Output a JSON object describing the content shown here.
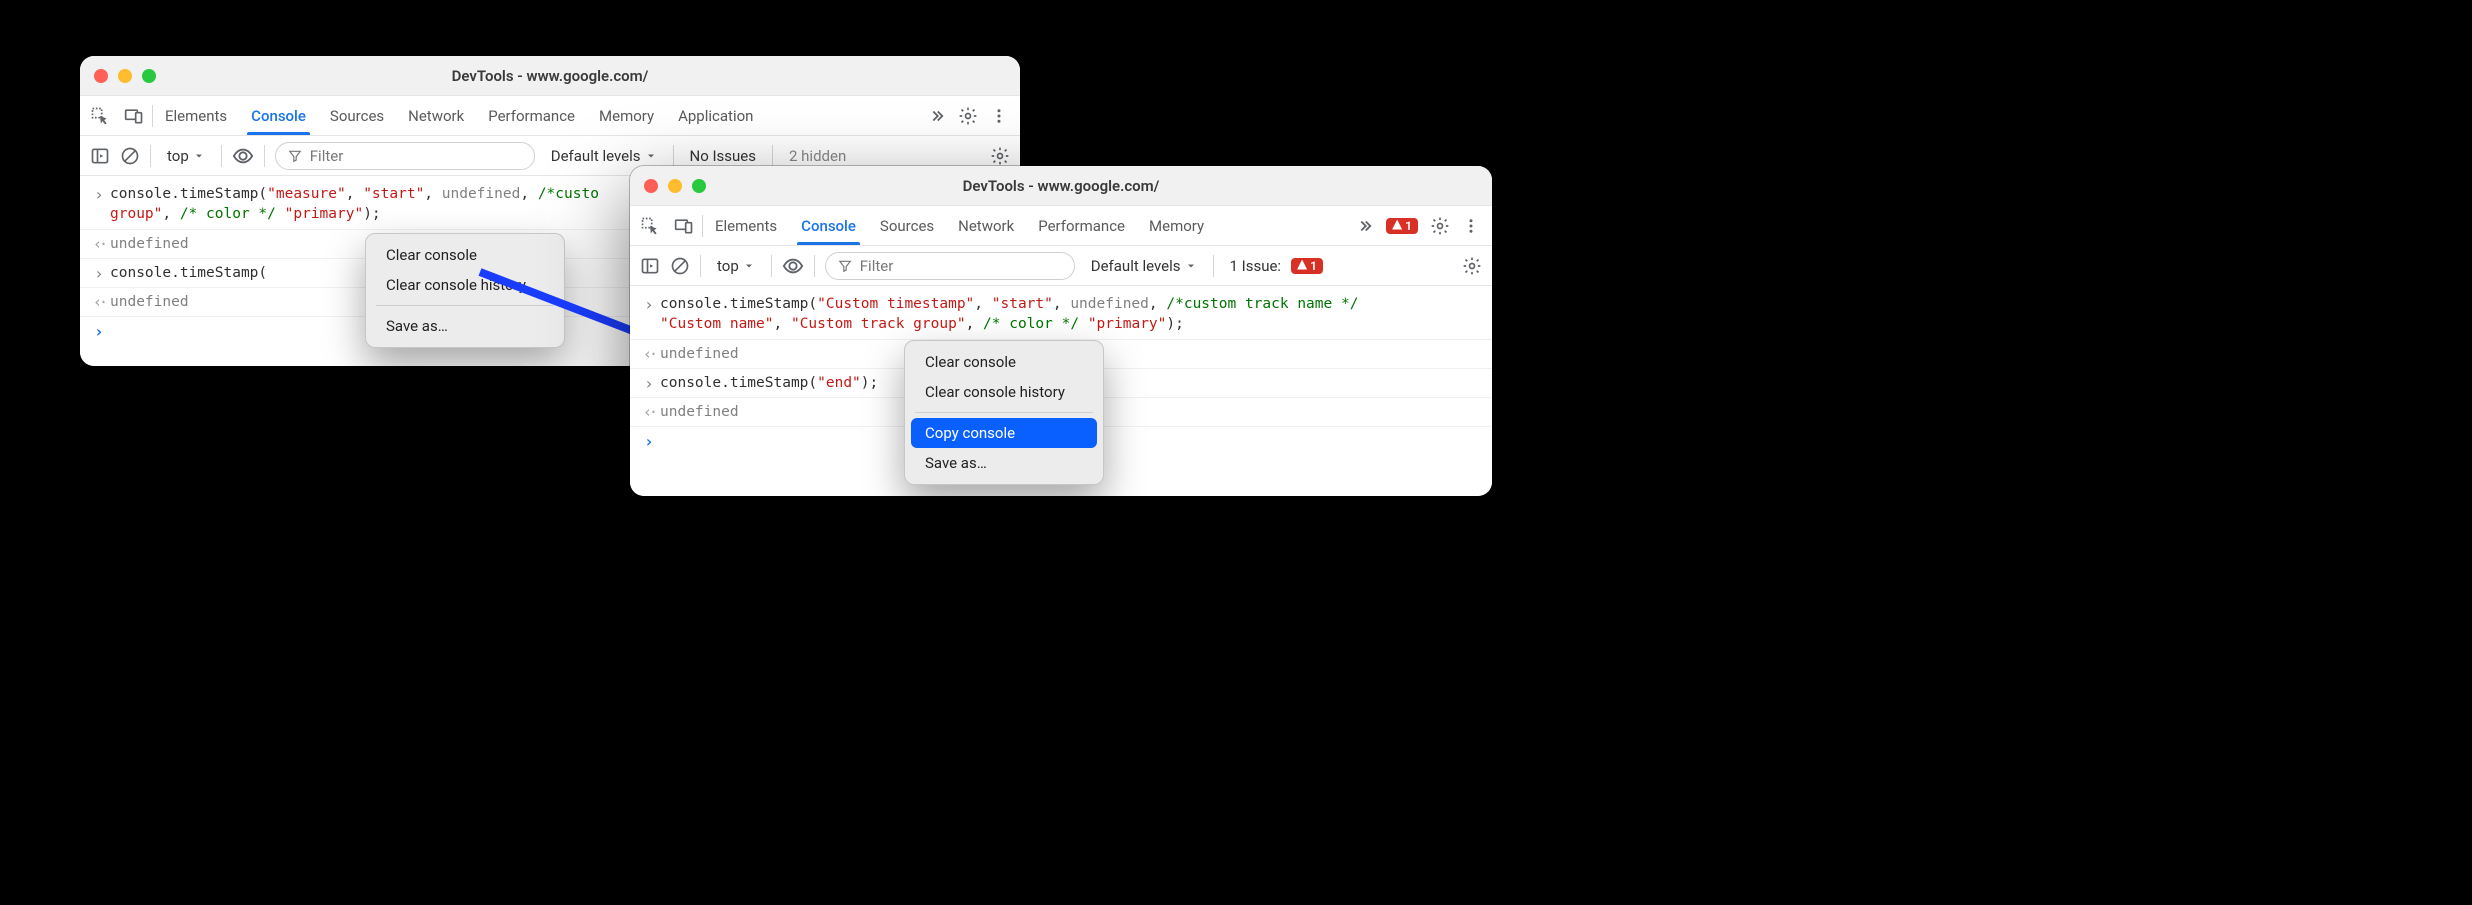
{
  "windowLeft": {
    "title": "DevTools - www.google.com/",
    "tabs": [
      "Elements",
      "Console",
      "Sources",
      "Network",
      "Performance",
      "Memory",
      "Application"
    ],
    "activeTab": "Console",
    "toolbar": {
      "context": "top",
      "filterPlaceholder": "Filter",
      "levels": "Default levels",
      "issues": "No Issues",
      "hidden": "2 hidden"
    },
    "log": {
      "l1_prefix": "console.timeStamp(",
      "l1_s1": "\"measure\"",
      "l1_comma1": ", ",
      "l1_s2": "\"start\"",
      "l1_comma2": ", ",
      "l1_undef": "undefined",
      "l1_comma3": ", ",
      "l1_c1": "/*custo",
      "l2_s3": "group\"",
      "l2_comma4": ", ",
      "l2_c2": "/* color */",
      "l2_space": " ",
      "l2_s4": "\"primary\"",
      "l2_close": ");",
      "r2_undef": "undefined",
      "l3_prefix": "console.timeStamp(",
      "r4_undef": "undefined"
    },
    "contextMenu": {
      "clear": "Clear console",
      "clearHist": "Clear console history",
      "saveAs": "Save as…"
    }
  },
  "windowRight": {
    "title": "DevTools - www.google.com/",
    "tabs": [
      "Elements",
      "Console",
      "Sources",
      "Network",
      "Performance",
      "Memory"
    ],
    "activeTab": "Console",
    "errorCount": "1",
    "toolbar": {
      "context": "top",
      "filterPlaceholder": "Filter",
      "levels": "Default levels",
      "issues": "1 Issue:",
      "issueCount": "1"
    },
    "log": {
      "l1_prefix": "console.timeStamp(",
      "l1_s1": "\"Custom timestamp\"",
      "l1_comma1": ", ",
      "l1_s2": "\"start\"",
      "l1_comma2": ", ",
      "l1_undef": "undefined",
      "l1_comma3": ", ",
      "l1_c1": "/*custom track name */",
      "l2_s3": "\"Custom name\"",
      "l2_comma4": ", ",
      "l2_s4": "\"Custom track group\"",
      "l2_comma5": ", ",
      "l2_c2": "/* color */",
      "l2_space": " ",
      "l2_s5": "\"primary\"",
      "l2_close": ");",
      "r2_undef": "undefined",
      "l3_prefix": "console.timeStamp(",
      "l3_s1": "\"end\"",
      "l3_close": ");",
      "r4_undef": "undefined"
    },
    "contextMenu": {
      "clear": "Clear console",
      "clearHist": "Clear console history",
      "copy": "Copy console",
      "saveAs": "Save as…"
    }
  }
}
